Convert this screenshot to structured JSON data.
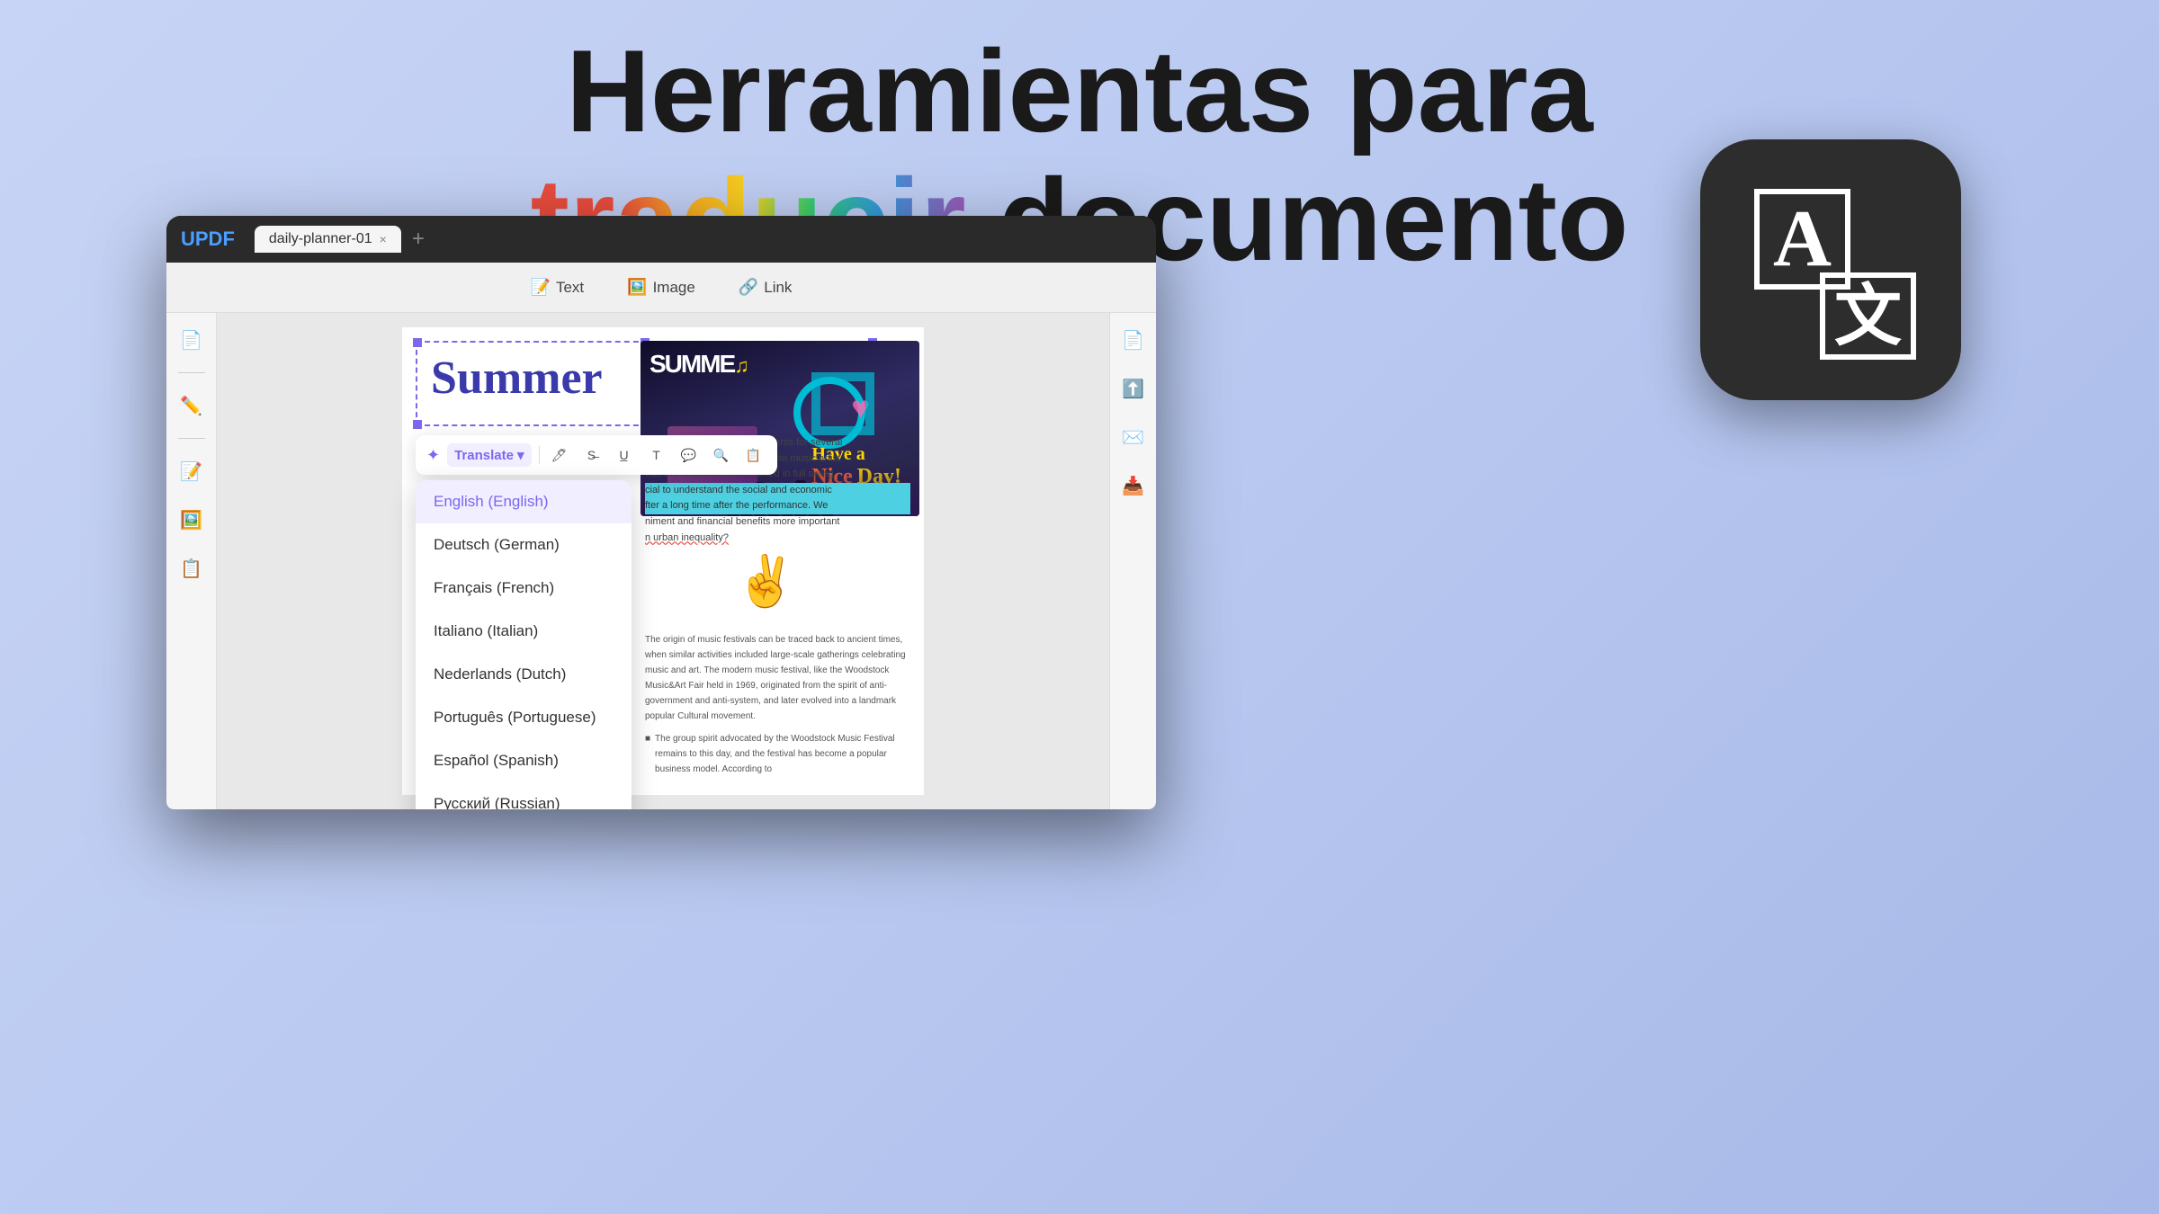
{
  "hero": {
    "line1": "Herramientas para",
    "line2_colored": "traducir",
    "line2_rest": " documento"
  },
  "translate_badge": {
    "letter_a": "A",
    "letter_zh": "文"
  },
  "app": {
    "logo": "UPDF",
    "tab_name": "daily-planner-01",
    "tab_close": "×",
    "tab_add": "+"
  },
  "toolbar": {
    "text_label": "Text",
    "image_label": "Image",
    "link_label": "Link"
  },
  "sidebar_icons": {
    "icon1": "📄",
    "icon2": "✏️",
    "icon3": "📝",
    "icon4": "🖼️",
    "icon5": "📋"
  },
  "right_sidebar_icons": {
    "icon1": "📄",
    "icon2": "⬆️",
    "icon3": "✉️",
    "icon4": "📥"
  },
  "pdf": {
    "summer_title": "Summer",
    "body_text_normal": "people would rather camp in tents for several",
    "body_text2": "mmer, just to watch their favorite music artist",
    "body_text3": "ear, the music festival returned in full swing",
    "body_text_highlighted": "cial to understand the social and economic",
    "body_text_highlighted2": "fter a long time after the performance. We",
    "body_text5": "niment and financial benefits more important",
    "body_text6": "n urban inequality?",
    "bottom_text1": "The origin of music festivals can be traced back to ancient times, when similar activities included large-scale gatherings celebrating music and art. The modern music festival, like the Woodstock Music&Art Fair held in 1969, originated from the spirit of anti-government and anti-system, and later evolved into a landmark popular Cultural movement.",
    "bottom_bullet": "The group spirit advocated by the Woodstock Music Festival remains to this day, and the festival has become a popular business model. According to"
  },
  "translate_toolbar": {
    "icon": "⚙️",
    "label": "Translate",
    "arrow": "▾"
  },
  "languages": [
    {
      "code": "en",
      "label": "English (English)",
      "selected": true
    },
    {
      "code": "de",
      "label": "Deutsch (German)",
      "selected": false
    },
    {
      "code": "fr",
      "label": "Français (French)",
      "selected": false
    },
    {
      "code": "it",
      "label": "Italiano (Italian)",
      "selected": false
    },
    {
      "code": "nl",
      "label": "Nederlands (Dutch)",
      "selected": false
    },
    {
      "code": "pt",
      "label": "Português (Portuguese)",
      "selected": false
    },
    {
      "code": "es",
      "label": "Español (Spanish)",
      "selected": false
    },
    {
      "code": "ru",
      "label": "Русский (Russian)",
      "selected": false
    }
  ],
  "festival": {
    "summer_text": "SUMME",
    "nice_day": "Have a Nice Day!"
  }
}
